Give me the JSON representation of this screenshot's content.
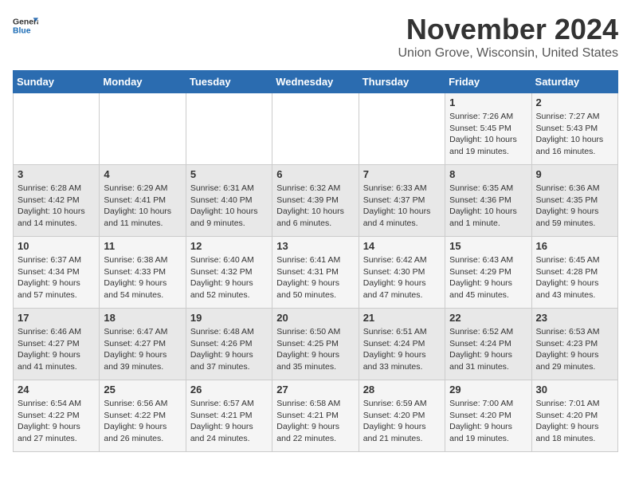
{
  "logo": {
    "general": "General",
    "blue": "Blue"
  },
  "title": "November 2024",
  "subtitle": "Union Grove, Wisconsin, United States",
  "header": {
    "accent_color": "#2b6cb0"
  },
  "days_of_week": [
    "Sunday",
    "Monday",
    "Tuesday",
    "Wednesday",
    "Thursday",
    "Friday",
    "Saturday"
  ],
  "weeks": [
    [
      {
        "day": "",
        "info": ""
      },
      {
        "day": "",
        "info": ""
      },
      {
        "day": "",
        "info": ""
      },
      {
        "day": "",
        "info": ""
      },
      {
        "day": "",
        "info": ""
      },
      {
        "day": "1",
        "info": "Sunrise: 7:26 AM\nSunset: 5:45 PM\nDaylight: 10 hours and 19 minutes."
      },
      {
        "day": "2",
        "info": "Sunrise: 7:27 AM\nSunset: 5:43 PM\nDaylight: 10 hours and 16 minutes."
      }
    ],
    [
      {
        "day": "3",
        "info": "Sunrise: 6:28 AM\nSunset: 4:42 PM\nDaylight: 10 hours and 14 minutes."
      },
      {
        "day": "4",
        "info": "Sunrise: 6:29 AM\nSunset: 4:41 PM\nDaylight: 10 hours and 11 minutes."
      },
      {
        "day": "5",
        "info": "Sunrise: 6:31 AM\nSunset: 4:40 PM\nDaylight: 10 hours and 9 minutes."
      },
      {
        "day": "6",
        "info": "Sunrise: 6:32 AM\nSunset: 4:39 PM\nDaylight: 10 hours and 6 minutes."
      },
      {
        "day": "7",
        "info": "Sunrise: 6:33 AM\nSunset: 4:37 PM\nDaylight: 10 hours and 4 minutes."
      },
      {
        "day": "8",
        "info": "Sunrise: 6:35 AM\nSunset: 4:36 PM\nDaylight: 10 hours and 1 minute."
      },
      {
        "day": "9",
        "info": "Sunrise: 6:36 AM\nSunset: 4:35 PM\nDaylight: 9 hours and 59 minutes."
      }
    ],
    [
      {
        "day": "10",
        "info": "Sunrise: 6:37 AM\nSunset: 4:34 PM\nDaylight: 9 hours and 57 minutes."
      },
      {
        "day": "11",
        "info": "Sunrise: 6:38 AM\nSunset: 4:33 PM\nDaylight: 9 hours and 54 minutes."
      },
      {
        "day": "12",
        "info": "Sunrise: 6:40 AM\nSunset: 4:32 PM\nDaylight: 9 hours and 52 minutes."
      },
      {
        "day": "13",
        "info": "Sunrise: 6:41 AM\nSunset: 4:31 PM\nDaylight: 9 hours and 50 minutes."
      },
      {
        "day": "14",
        "info": "Sunrise: 6:42 AM\nSunset: 4:30 PM\nDaylight: 9 hours and 47 minutes."
      },
      {
        "day": "15",
        "info": "Sunrise: 6:43 AM\nSunset: 4:29 PM\nDaylight: 9 hours and 45 minutes."
      },
      {
        "day": "16",
        "info": "Sunrise: 6:45 AM\nSunset: 4:28 PM\nDaylight: 9 hours and 43 minutes."
      }
    ],
    [
      {
        "day": "17",
        "info": "Sunrise: 6:46 AM\nSunset: 4:27 PM\nDaylight: 9 hours and 41 minutes."
      },
      {
        "day": "18",
        "info": "Sunrise: 6:47 AM\nSunset: 4:27 PM\nDaylight: 9 hours and 39 minutes."
      },
      {
        "day": "19",
        "info": "Sunrise: 6:48 AM\nSunset: 4:26 PM\nDaylight: 9 hours and 37 minutes."
      },
      {
        "day": "20",
        "info": "Sunrise: 6:50 AM\nSunset: 4:25 PM\nDaylight: 9 hours and 35 minutes."
      },
      {
        "day": "21",
        "info": "Sunrise: 6:51 AM\nSunset: 4:24 PM\nDaylight: 9 hours and 33 minutes."
      },
      {
        "day": "22",
        "info": "Sunrise: 6:52 AM\nSunset: 4:24 PM\nDaylight: 9 hours and 31 minutes."
      },
      {
        "day": "23",
        "info": "Sunrise: 6:53 AM\nSunset: 4:23 PM\nDaylight: 9 hours and 29 minutes."
      }
    ],
    [
      {
        "day": "24",
        "info": "Sunrise: 6:54 AM\nSunset: 4:22 PM\nDaylight: 9 hours and 27 minutes."
      },
      {
        "day": "25",
        "info": "Sunrise: 6:56 AM\nSunset: 4:22 PM\nDaylight: 9 hours and 26 minutes."
      },
      {
        "day": "26",
        "info": "Sunrise: 6:57 AM\nSunset: 4:21 PM\nDaylight: 9 hours and 24 minutes."
      },
      {
        "day": "27",
        "info": "Sunrise: 6:58 AM\nSunset: 4:21 PM\nDaylight: 9 hours and 22 minutes."
      },
      {
        "day": "28",
        "info": "Sunrise: 6:59 AM\nSunset: 4:20 PM\nDaylight: 9 hours and 21 minutes."
      },
      {
        "day": "29",
        "info": "Sunrise: 7:00 AM\nSunset: 4:20 PM\nDaylight: 9 hours and 19 minutes."
      },
      {
        "day": "30",
        "info": "Sunrise: 7:01 AM\nSunset: 4:20 PM\nDaylight: 9 hours and 18 minutes."
      }
    ]
  ]
}
